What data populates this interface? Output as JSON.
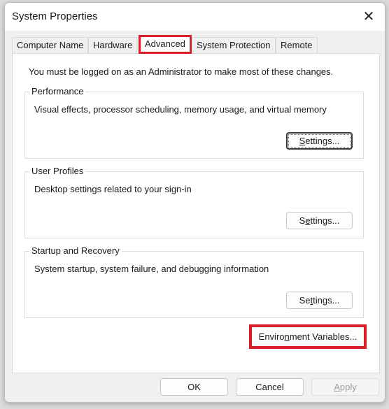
{
  "window": {
    "title": "System Properties",
    "close_icon": "close-icon"
  },
  "tabs": [
    {
      "label": "Computer Name"
    },
    {
      "label": "Hardware"
    },
    {
      "label": "Advanced",
      "active": true
    },
    {
      "label": "System Protection"
    },
    {
      "label": "Remote"
    }
  ],
  "main": {
    "note": "You must be logged on as an Administrator to make most of these changes.",
    "groups": [
      {
        "label": "Performance",
        "description": "Visual effects, processor scheduling, memory usage, and virtual memory",
        "button": {
          "pre": "",
          "key": "S",
          "post": "ettings..."
        }
      },
      {
        "label": "User Profiles",
        "description": "Desktop settings related to your sign-in",
        "button": {
          "pre": "S",
          "key": "e",
          "post": "ttings..."
        }
      },
      {
        "label": "Startup and Recovery",
        "description": "System startup, system failure, and debugging information",
        "button": {
          "pre": "Se",
          "key": "t",
          "post": "tings..."
        }
      }
    ],
    "env_button": {
      "pre": "Enviro",
      "key": "n",
      "post": "ment Variables..."
    }
  },
  "footer": {
    "ok": "OK",
    "cancel": "Cancel",
    "apply": {
      "pre": "",
      "key": "A",
      "post": "pply"
    }
  },
  "colors": {
    "highlight": "#d81f2a"
  }
}
